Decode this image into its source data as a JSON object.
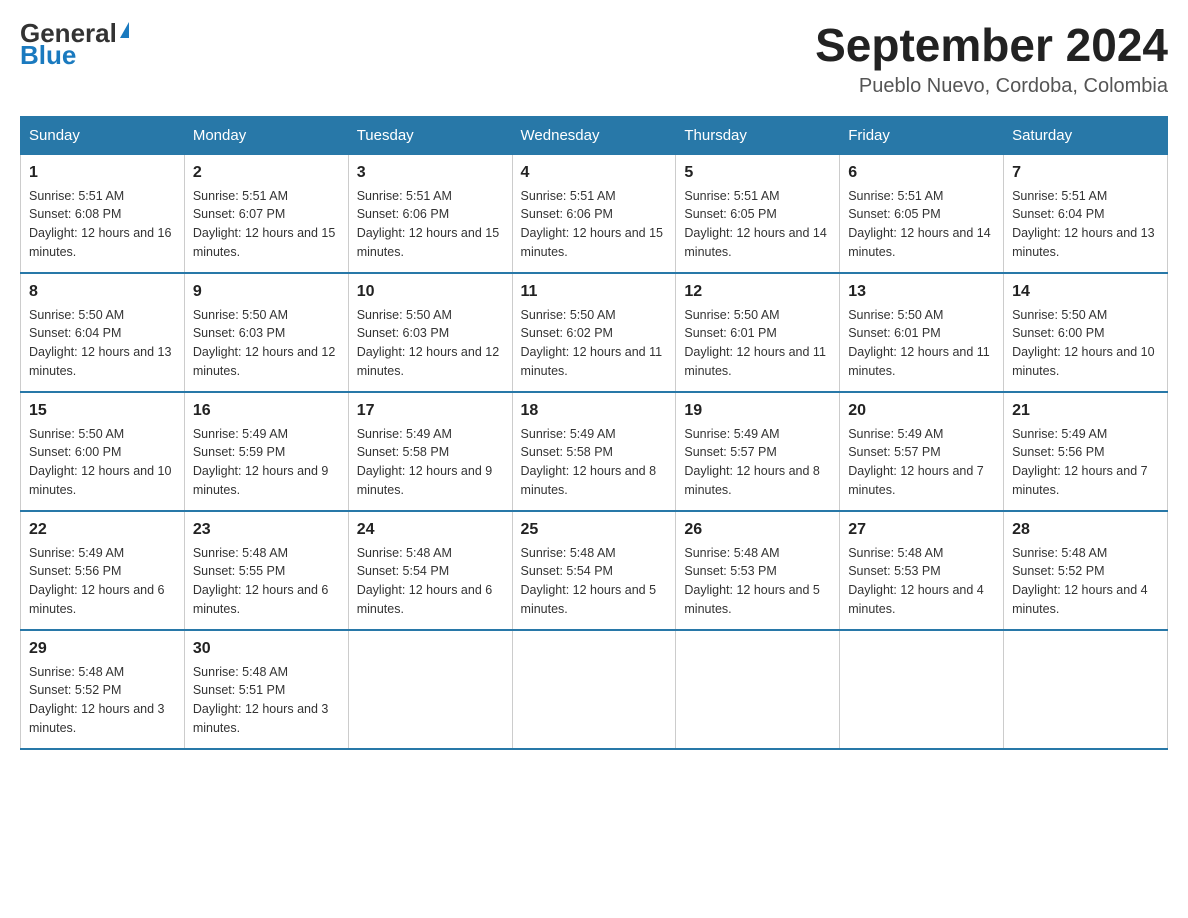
{
  "header": {
    "logo": {
      "general_text": "General",
      "blue_text": "Blue"
    },
    "title": "September 2024",
    "location": "Pueblo Nuevo, Cordoba, Colombia"
  },
  "days_of_week": [
    "Sunday",
    "Monday",
    "Tuesday",
    "Wednesday",
    "Thursday",
    "Friday",
    "Saturday"
  ],
  "weeks": [
    [
      {
        "day": "1",
        "sunrise": "Sunrise: 5:51 AM",
        "sunset": "Sunset: 6:08 PM",
        "daylight": "Daylight: 12 hours and 16 minutes."
      },
      {
        "day": "2",
        "sunrise": "Sunrise: 5:51 AM",
        "sunset": "Sunset: 6:07 PM",
        "daylight": "Daylight: 12 hours and 15 minutes."
      },
      {
        "day": "3",
        "sunrise": "Sunrise: 5:51 AM",
        "sunset": "Sunset: 6:06 PM",
        "daylight": "Daylight: 12 hours and 15 minutes."
      },
      {
        "day": "4",
        "sunrise": "Sunrise: 5:51 AM",
        "sunset": "Sunset: 6:06 PM",
        "daylight": "Daylight: 12 hours and 15 minutes."
      },
      {
        "day": "5",
        "sunrise": "Sunrise: 5:51 AM",
        "sunset": "Sunset: 6:05 PM",
        "daylight": "Daylight: 12 hours and 14 minutes."
      },
      {
        "day": "6",
        "sunrise": "Sunrise: 5:51 AM",
        "sunset": "Sunset: 6:05 PM",
        "daylight": "Daylight: 12 hours and 14 minutes."
      },
      {
        "day": "7",
        "sunrise": "Sunrise: 5:51 AM",
        "sunset": "Sunset: 6:04 PM",
        "daylight": "Daylight: 12 hours and 13 minutes."
      }
    ],
    [
      {
        "day": "8",
        "sunrise": "Sunrise: 5:50 AM",
        "sunset": "Sunset: 6:04 PM",
        "daylight": "Daylight: 12 hours and 13 minutes."
      },
      {
        "day": "9",
        "sunrise": "Sunrise: 5:50 AM",
        "sunset": "Sunset: 6:03 PM",
        "daylight": "Daylight: 12 hours and 12 minutes."
      },
      {
        "day": "10",
        "sunrise": "Sunrise: 5:50 AM",
        "sunset": "Sunset: 6:03 PM",
        "daylight": "Daylight: 12 hours and 12 minutes."
      },
      {
        "day": "11",
        "sunrise": "Sunrise: 5:50 AM",
        "sunset": "Sunset: 6:02 PM",
        "daylight": "Daylight: 12 hours and 11 minutes."
      },
      {
        "day": "12",
        "sunrise": "Sunrise: 5:50 AM",
        "sunset": "Sunset: 6:01 PM",
        "daylight": "Daylight: 12 hours and 11 minutes."
      },
      {
        "day": "13",
        "sunrise": "Sunrise: 5:50 AM",
        "sunset": "Sunset: 6:01 PM",
        "daylight": "Daylight: 12 hours and 11 minutes."
      },
      {
        "day": "14",
        "sunrise": "Sunrise: 5:50 AM",
        "sunset": "Sunset: 6:00 PM",
        "daylight": "Daylight: 12 hours and 10 minutes."
      }
    ],
    [
      {
        "day": "15",
        "sunrise": "Sunrise: 5:50 AM",
        "sunset": "Sunset: 6:00 PM",
        "daylight": "Daylight: 12 hours and 10 minutes."
      },
      {
        "day": "16",
        "sunrise": "Sunrise: 5:49 AM",
        "sunset": "Sunset: 5:59 PM",
        "daylight": "Daylight: 12 hours and 9 minutes."
      },
      {
        "day": "17",
        "sunrise": "Sunrise: 5:49 AM",
        "sunset": "Sunset: 5:58 PM",
        "daylight": "Daylight: 12 hours and 9 minutes."
      },
      {
        "day": "18",
        "sunrise": "Sunrise: 5:49 AM",
        "sunset": "Sunset: 5:58 PM",
        "daylight": "Daylight: 12 hours and 8 minutes."
      },
      {
        "day": "19",
        "sunrise": "Sunrise: 5:49 AM",
        "sunset": "Sunset: 5:57 PM",
        "daylight": "Daylight: 12 hours and 8 minutes."
      },
      {
        "day": "20",
        "sunrise": "Sunrise: 5:49 AM",
        "sunset": "Sunset: 5:57 PM",
        "daylight": "Daylight: 12 hours and 7 minutes."
      },
      {
        "day": "21",
        "sunrise": "Sunrise: 5:49 AM",
        "sunset": "Sunset: 5:56 PM",
        "daylight": "Daylight: 12 hours and 7 minutes."
      }
    ],
    [
      {
        "day": "22",
        "sunrise": "Sunrise: 5:49 AM",
        "sunset": "Sunset: 5:56 PM",
        "daylight": "Daylight: 12 hours and 6 minutes."
      },
      {
        "day": "23",
        "sunrise": "Sunrise: 5:48 AM",
        "sunset": "Sunset: 5:55 PM",
        "daylight": "Daylight: 12 hours and 6 minutes."
      },
      {
        "day": "24",
        "sunrise": "Sunrise: 5:48 AM",
        "sunset": "Sunset: 5:54 PM",
        "daylight": "Daylight: 12 hours and 6 minutes."
      },
      {
        "day": "25",
        "sunrise": "Sunrise: 5:48 AM",
        "sunset": "Sunset: 5:54 PM",
        "daylight": "Daylight: 12 hours and 5 minutes."
      },
      {
        "day": "26",
        "sunrise": "Sunrise: 5:48 AM",
        "sunset": "Sunset: 5:53 PM",
        "daylight": "Daylight: 12 hours and 5 minutes."
      },
      {
        "day": "27",
        "sunrise": "Sunrise: 5:48 AM",
        "sunset": "Sunset: 5:53 PM",
        "daylight": "Daylight: 12 hours and 4 minutes."
      },
      {
        "day": "28",
        "sunrise": "Sunrise: 5:48 AM",
        "sunset": "Sunset: 5:52 PM",
        "daylight": "Daylight: 12 hours and 4 minutes."
      }
    ],
    [
      {
        "day": "29",
        "sunrise": "Sunrise: 5:48 AM",
        "sunset": "Sunset: 5:52 PM",
        "daylight": "Daylight: 12 hours and 3 minutes."
      },
      {
        "day": "30",
        "sunrise": "Sunrise: 5:48 AM",
        "sunset": "Sunset: 5:51 PM",
        "daylight": "Daylight: 12 hours and 3 minutes."
      },
      null,
      null,
      null,
      null,
      null
    ]
  ]
}
